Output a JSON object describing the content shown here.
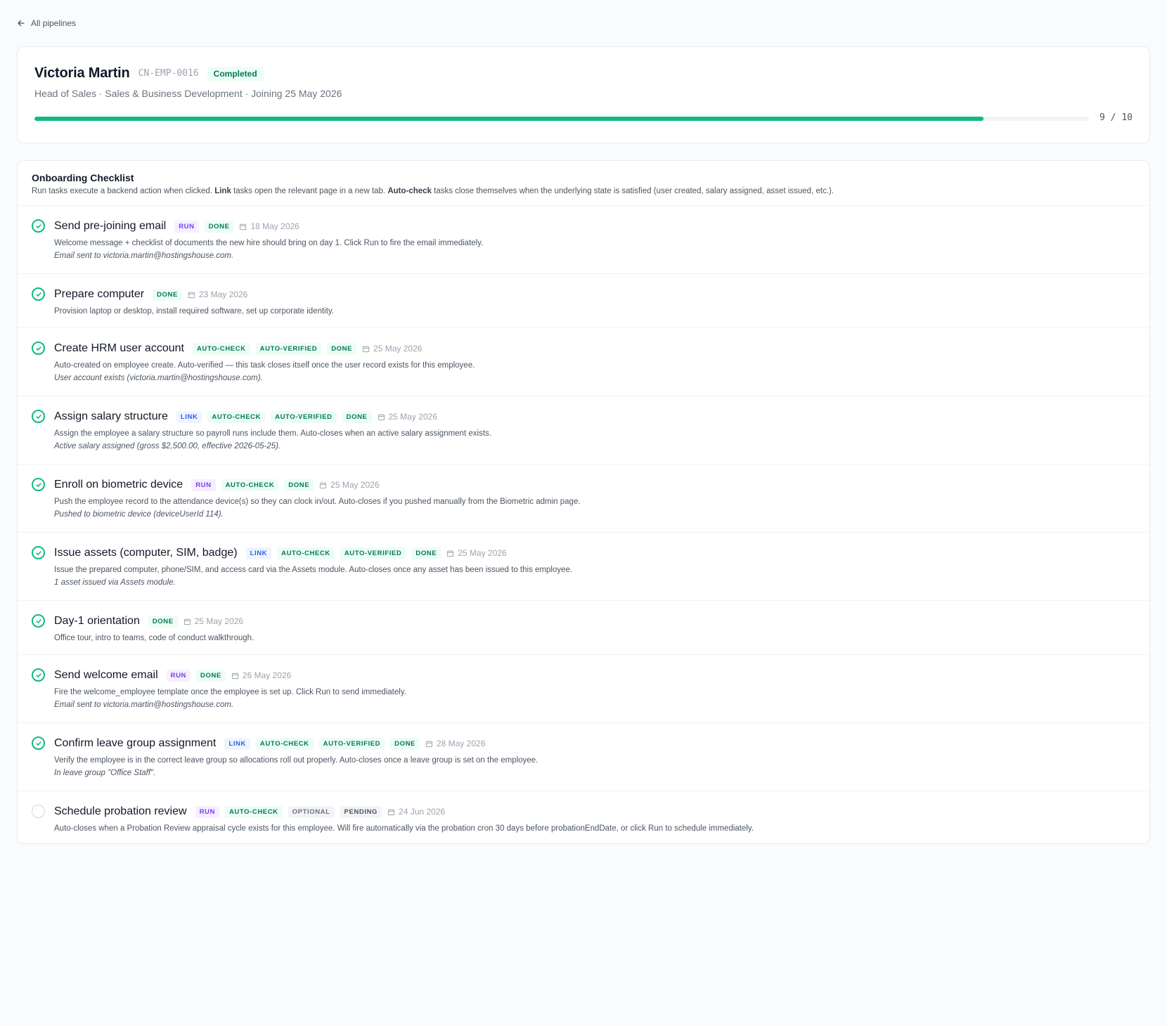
{
  "nav": {
    "back_label": "All pipelines"
  },
  "employee": {
    "name": "Victoria Martin",
    "code": "CN-EMP-0016",
    "status": "Completed",
    "subtitle": "Head of Sales · Sales & Business Development · Joining 25 May 2026",
    "progress_text": "9 / 10",
    "progress_fraction": 0.9
  },
  "checklist": {
    "title": "Onboarding Checklist",
    "intro": {
      "run_word": "Run",
      "part1": " tasks execute a backend action when clicked. ",
      "link_word": "Link",
      "part2": " tasks open the relevant page in a new tab. ",
      "auto_word": "Auto-check",
      "part3": " tasks close themselves when the underlying state is satisfied (user created, salary assigned, asset issued, etc.)."
    },
    "tasks": [
      {
        "title": "Send pre-joining email",
        "tags": [
          [
            "RUN",
            "run"
          ],
          [
            "DONE",
            "done"
          ]
        ],
        "date": "18 May 2026",
        "desc": "Welcome message + checklist of documents the new hire should bring on day 1. Click Run to fire the email immediately.",
        "note": "Email sent to victoria.martin@hostingshouse.com.",
        "done": true
      },
      {
        "title": "Prepare computer",
        "tags": [
          [
            "DONE",
            "done"
          ]
        ],
        "date": "23 May 2026",
        "desc": "Provision laptop or desktop, install required software, set up corporate identity.",
        "note": "",
        "done": true
      },
      {
        "title": "Create HRM user account",
        "tags": [
          [
            "AUTO-CHECK",
            "auto"
          ],
          [
            "AUTO-VERIFIED",
            "auto"
          ],
          [
            "DONE",
            "done"
          ]
        ],
        "date": "25 May 2026",
        "desc": "Auto-created on employee create. Auto-verified — this task closes itself once the user record exists for this employee.",
        "note": "User account exists (victoria.martin@hostingshouse.com).",
        "done": true
      },
      {
        "title": "Assign salary structure",
        "tags": [
          [
            "LINK",
            "link"
          ],
          [
            "AUTO-CHECK",
            "auto"
          ],
          [
            "AUTO-VERIFIED",
            "auto"
          ],
          [
            "DONE",
            "done"
          ]
        ],
        "date": "25 May 2026",
        "desc": "Assign the employee a salary structure so payroll runs include them. Auto-closes when an active salary assignment exists.",
        "note": "Active salary assigned (gross $2,500.00, effective 2026-05-25).",
        "done": true
      },
      {
        "title": "Enroll on biometric device",
        "tags": [
          [
            "RUN",
            "run"
          ],
          [
            "AUTO-CHECK",
            "auto"
          ],
          [
            "DONE",
            "done"
          ]
        ],
        "date": "25 May 2026",
        "desc": "Push the employee record to the attendance device(s) so they can clock in/out. Auto-closes if you pushed manually from the Biometric admin page.",
        "note": "Pushed to biometric device (deviceUserId 114).",
        "done": true
      },
      {
        "title": "Issue assets (computer, SIM, badge)",
        "tags": [
          [
            "LINK",
            "link"
          ],
          [
            "AUTO-CHECK",
            "auto"
          ],
          [
            "AUTO-VERIFIED",
            "auto"
          ],
          [
            "DONE",
            "done"
          ]
        ],
        "date": "25 May 2026",
        "desc": "Issue the prepared computer, phone/SIM, and access card via the Assets module. Auto-closes once any asset has been issued to this employee.",
        "note": "1 asset issued via Assets module.",
        "done": true
      },
      {
        "title": "Day-1 orientation",
        "tags": [
          [
            "DONE",
            "done"
          ]
        ],
        "date": "25 May 2026",
        "desc": "Office tour, intro to teams, code of conduct walkthrough.",
        "note": "",
        "done": true
      },
      {
        "title": "Send welcome email",
        "tags": [
          [
            "RUN",
            "run"
          ],
          [
            "DONE",
            "done"
          ]
        ],
        "date": "26 May 2026",
        "desc": "Fire the welcome_employee template once the employee is set up. Click Run to send immediately.",
        "note": "Email sent to victoria.martin@hostingshouse.com.",
        "done": true
      },
      {
        "title": "Confirm leave group assignment",
        "tags": [
          [
            "LINK",
            "link"
          ],
          [
            "AUTO-CHECK",
            "auto"
          ],
          [
            "AUTO-VERIFIED",
            "auto"
          ],
          [
            "DONE",
            "done"
          ]
        ],
        "date": "28 May 2026",
        "desc": "Verify the employee is in the correct leave group so allocations roll out properly. Auto-closes once a leave group is set on the employee.",
        "note": "In leave group \"Office Staff\".",
        "done": true
      },
      {
        "title": "Schedule probation review",
        "tags": [
          [
            "RUN",
            "run"
          ],
          [
            "AUTO-CHECK",
            "auto"
          ],
          [
            "OPTIONAL",
            "optional"
          ],
          [
            "PENDING",
            "pending"
          ]
        ],
        "date": "24 Jun 2026",
        "desc": "Auto-closes when a Probation Review appraisal cycle exists for this employee. Will fire automatically via the probation cron 30 days before probationEndDate, or click Run to schedule immediately.",
        "note": "",
        "done": false
      }
    ]
  },
  "colors": {
    "accent": "#10b981",
    "run": "#7c3aed",
    "link": "#2563eb",
    "done": "#047857"
  },
  "icons": {
    "back": "arrow-left-icon",
    "check": "check-circle-icon",
    "calendar": "calendar-icon"
  }
}
